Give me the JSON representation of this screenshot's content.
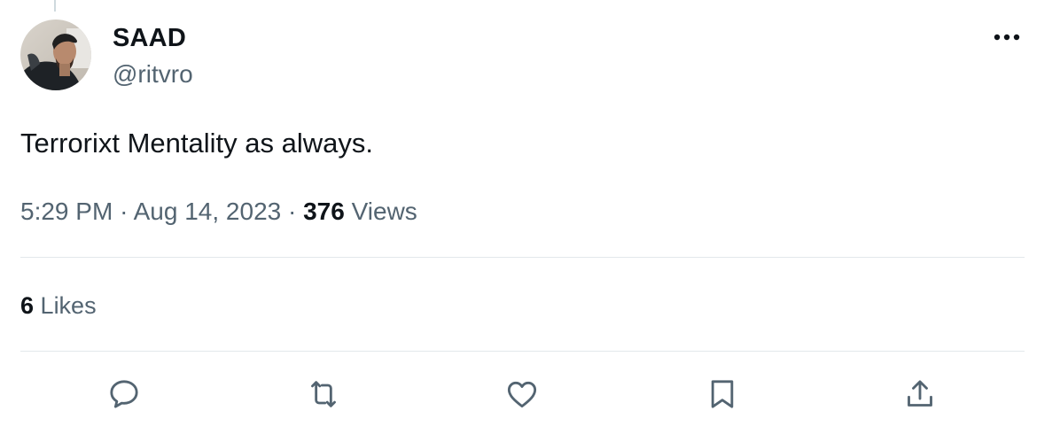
{
  "tweet": {
    "author": {
      "display_name": "SAAD",
      "handle": "@ritvro",
      "avatar_icon": "profile-photo"
    },
    "text": "Terrorixt Mentality as always.",
    "time": "5:29 PM",
    "separator": "·",
    "date": "Aug 14, 2023",
    "views_count": "376",
    "views_label": "Views",
    "likes_count": "6",
    "likes_label": "Likes"
  },
  "actions": [
    {
      "name": "reply",
      "icon": "reply-bubble-icon"
    },
    {
      "name": "retweet",
      "icon": "retweet-icon"
    },
    {
      "name": "like",
      "icon": "heart-icon"
    },
    {
      "name": "bookmark",
      "icon": "bookmark-icon"
    },
    {
      "name": "share",
      "icon": "share-upload-icon"
    }
  ],
  "colors": {
    "primary_text": "#0f1419",
    "secondary_text": "#536471",
    "divider": "#e3e8eb",
    "background": "#ffffff"
  }
}
